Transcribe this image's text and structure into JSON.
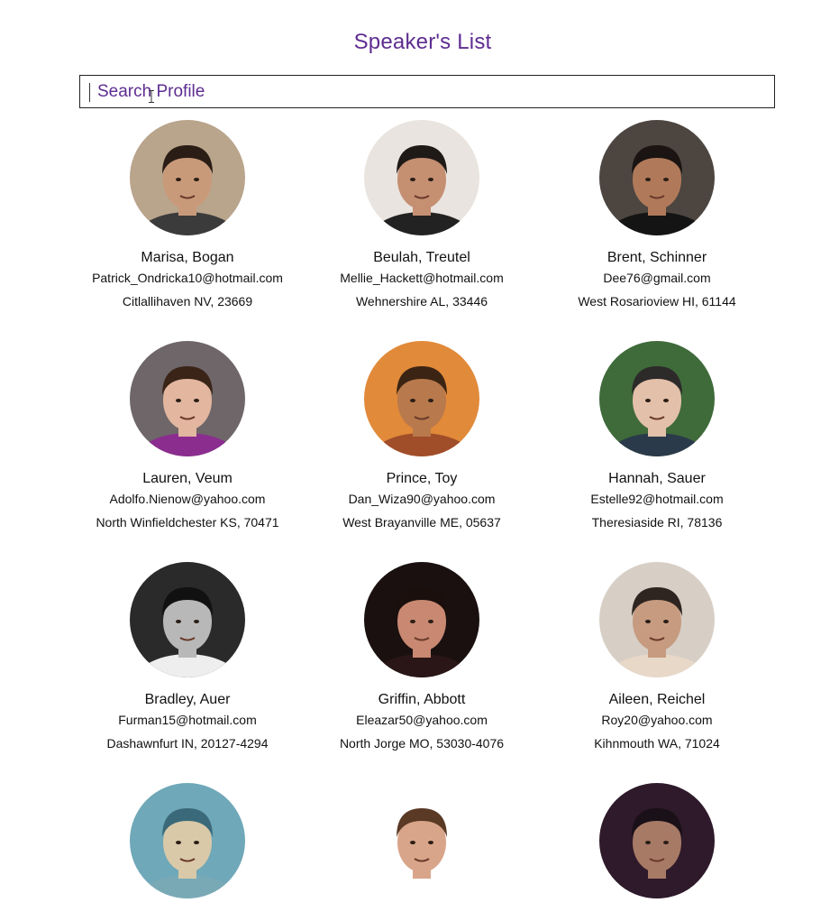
{
  "page": {
    "title": "Speaker's List"
  },
  "search": {
    "placeholder": "Search Profile",
    "value": ""
  },
  "speakers": [
    {
      "name": "Marisa, Bogan",
      "email": "Patrick_Ondricka10@hotmail.com",
      "address": "Citlallihaven NV, 23669"
    },
    {
      "name": "Beulah, Treutel",
      "email": "Mellie_Hackett@hotmail.com",
      "address": "Wehnershire AL, 33446"
    },
    {
      "name": "Brent, Schinner",
      "email": "Dee76@gmail.com",
      "address": "West Rosarioview HI, 61144"
    },
    {
      "name": "Lauren, Veum",
      "email": "Adolfo.Nienow@yahoo.com",
      "address": "North Winfieldchester KS, 70471"
    },
    {
      "name": "Prince, Toy",
      "email": "Dan_Wiza90@yahoo.com",
      "address": "West Brayanville ME, 05637"
    },
    {
      "name": "Hannah, Sauer",
      "email": "Estelle92@hotmail.com",
      "address": "Theresiaside RI, 78136"
    },
    {
      "name": "Bradley, Auer",
      "email": "Furman15@hotmail.com",
      "address": "Dashawnfurt IN, 20127-4294"
    },
    {
      "name": "Griffin, Abbott",
      "email": "Eleazar50@yahoo.com",
      "address": "North Jorge MO, 53030-4076"
    },
    {
      "name": "Aileen, Reichel",
      "email": "Roy20@yahoo.com",
      "address": "Kihnmouth WA, 71024"
    },
    {
      "name": "",
      "email": "",
      "address": ""
    },
    {
      "name": "",
      "email": "",
      "address": ""
    },
    {
      "name": "",
      "email": "",
      "address": ""
    }
  ],
  "avatars": [
    {
      "icon": "avatar-photo-icon",
      "bg": "#b9a48c",
      "skin": "#c99a7a",
      "hair": "#2a1d15",
      "shirt": "#3b3b3b"
    },
    {
      "icon": "avatar-photo-icon",
      "bg": "#e9e4df",
      "skin": "#c58f72",
      "hair": "#1f1a17",
      "shirt": "#222222"
    },
    {
      "icon": "avatar-photo-icon",
      "bg": "#4c4540",
      "skin": "#b07a5a",
      "hair": "#1a1412",
      "shirt": "#141414"
    },
    {
      "icon": "avatar-photo-icon",
      "bg": "#6e6668",
      "skin": "#e2b69f",
      "hair": "#3a2418",
      "shirt": "#8b2d8f"
    },
    {
      "icon": "avatar-photo-icon",
      "bg": "#e18a3a",
      "skin": "#b8794c",
      "hair": "#3b2414",
      "shirt": "#a04d2a"
    },
    {
      "icon": "avatar-photo-icon",
      "bg": "#3f6a3a",
      "skin": "#e3c0aa",
      "hair": "#2d2a2a",
      "shirt": "#2a3a4a"
    },
    {
      "icon": "avatar-photo-icon",
      "bg": "#2a2a2a",
      "skin": "#b8b8b8",
      "hair": "#111111",
      "shirt": "#eeeeee"
    },
    {
      "icon": "avatar-photo-icon",
      "bg": "#1a1010",
      "skin": "#c88872",
      "hair": "#1a0f0c",
      "shirt": "#2a1616"
    },
    {
      "icon": "avatar-photo-icon",
      "bg": "#d7cfc6",
      "skin": "#c69b80",
      "hair": "#2e2520",
      "shirt": "#e8d8c8"
    },
    {
      "icon": "avatar-photo-icon",
      "bg": "#6fa8b8",
      "skin": "#d9c9a9",
      "hair": "#3a6a7a",
      "shirt": "#7aa9b6"
    },
    {
      "icon": "avatar-photo-icon",
      "bg": "#ffffff",
      "skin": "#d9a58a",
      "hair": "#5a3a25",
      "shirt": "#ffffff"
    },
    {
      "icon": "avatar-photo-icon",
      "bg": "#2e1a2a",
      "skin": "#a77a66",
      "hair": "#1a1018",
      "shirt": "#2e1a2a"
    }
  ]
}
